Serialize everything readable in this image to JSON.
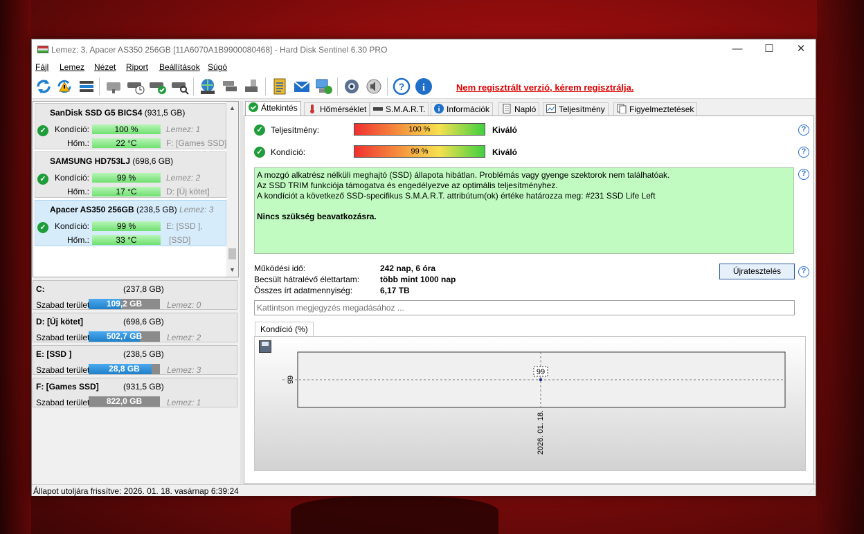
{
  "window": {
    "title": "Lemez: 3, Apacer AS350 256GB [11A6070A1B9900080468]  -  Hard Disk Sentinel 6.30 PRO",
    "minimize": "—",
    "maximize": "☐",
    "close": "✕"
  },
  "menu": [
    "Fájl",
    "Lemez",
    "Nézet",
    "Riport",
    "Beállítások",
    "Súgó"
  ],
  "toolbar": {
    "icons": [
      "refresh-icon",
      "warning-refresh-icon",
      "disk-info-icon",
      "disk-test-icon",
      "disk-schedule-icon",
      "disk-ok-icon",
      "disk-search-icon",
      "network-icon",
      "disks-icon",
      "disk-export-icon",
      "report-icon",
      "email-icon",
      "remote-icon",
      "settings-icon",
      "sound-icon",
      "help-icon",
      "info-icon"
    ],
    "register_text": "Nem regisztrált verzió, kérem regisztrálja."
  },
  "disks": [
    {
      "name": "SanDisk SSD G5 BICS4",
      "size": "(931,5 GB)",
      "lemez": "",
      "cond_label": "Kondíció:",
      "cond_value": "100 %",
      "cond_extra": "Lemez: 1",
      "temp_label": "Hőm.:",
      "temp_value": "22 °C",
      "temp_extra": "F: [Games SSD]"
    },
    {
      "name": "SAMSUNG HD753LJ",
      "size": "(698,6 GB)",
      "lemez": "",
      "cond_label": "Kondíció:",
      "cond_value": "99 %",
      "cond_extra": "Lemez: 2",
      "temp_label": "Hőm.:",
      "temp_value": "17 °C",
      "temp_extra": "D: [Új kötet]"
    },
    {
      "name": "Apacer AS350 256GB",
      "size": "(238,5 GB)",
      "lemez": "Lemez: 3",
      "cond_label": "Kondíció:",
      "cond_value": "99 %",
      "cond_extra": "E: [SSD ],",
      "temp_label": "Hőm.:",
      "temp_value": "33 °C",
      "temp_extra": "[SSD]"
    }
  ],
  "volumes": [
    {
      "name": "C:",
      "size": "(237,8 GB)",
      "free_label": "Szabad terület",
      "free": "109,2 GB",
      "free_fraction": 0.46,
      "lemez": "Lemez: 0"
    },
    {
      "name": "D: [Új kötet]",
      "size": "(698,6 GB)",
      "free_label": "Szabad terület",
      "free": "502,7 GB",
      "free_fraction": 0.72,
      "lemez": "Lemez: 2"
    },
    {
      "name": "E: [SSD ]",
      "size": "(238,5 GB)",
      "free_label": "Szabad terület",
      "free": "28,8 GB",
      "free_fraction": 0.88,
      "lemez": "Lemez: 3"
    },
    {
      "name": "F: [Games SSD]",
      "size": "(931,5 GB)",
      "free_label": "Szabad terület",
      "free": "822,0 GB",
      "free_fraction": 0.0,
      "lemez": "Lemez: 1"
    }
  ],
  "tabs": [
    "Áttekintés",
    "Hőmérséklet",
    "S.M.A.R.T.",
    "Információk",
    "Napló",
    "Teljesítmény",
    "Figyelmeztetések"
  ],
  "overview": {
    "performance_label": "Teljesítmény:",
    "performance_value": "100 %",
    "performance_rating": "Kiváló",
    "condition_label": "Kondíció:",
    "condition_value": "99 %",
    "condition_rating": "Kiváló",
    "status_lines": [
      "A mozgó alkatrész nélküli meghajtó (SSD) állapota hibátlan. Problémás vagy gyenge szektorok nem találhatóak.",
      "Az SSD TRIM funkciója támogatva és engedélyezve az optimális teljesítményhez.",
      "A kondíciót a következő SSD-specifikus S.M.A.R.T. attribútum(ok) értéke határozza meg:  #231 SSD Life Left"
    ],
    "status_conclusion": "Nincs szükség beavatkozásra.",
    "uptime_label": "Működési idő:",
    "uptime_value": "242 nap, 6 óra",
    "lifetime_label": "Becsült hátralévő élettartam:",
    "lifetime_value": "több mint 1000 nap",
    "written_label": "Összes írt adatmennyiség:",
    "written_value": "6,17 TB",
    "retest_button": "Újratesztelés",
    "note_placeholder": "Kattintson megjegyzés megadásához ..."
  },
  "chart_tab": "Kondíció  (%)",
  "chart_data": {
    "type": "line",
    "x": [
      "2026. 01. 18."
    ],
    "series": [
      {
        "values": [
          99
        ]
      }
    ],
    "y_tick": "99",
    "data_labels": [
      "99"
    ]
  },
  "statusbar": "Állapot utoljára frissítve: 2026. 01. 18. vasárnap 6:39:24"
}
